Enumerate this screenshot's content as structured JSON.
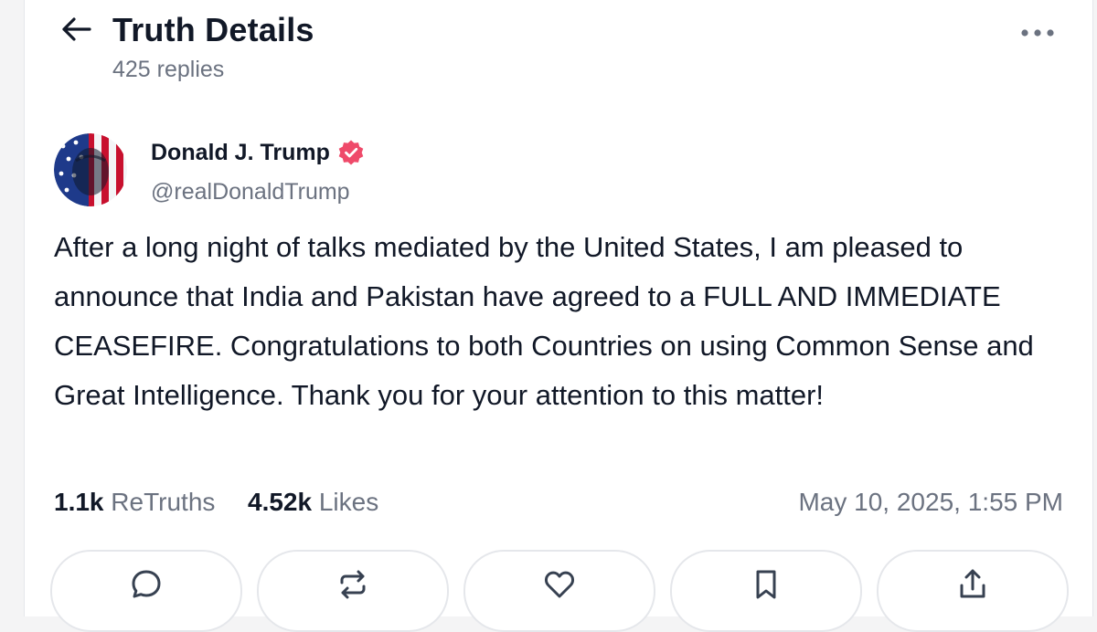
{
  "header": {
    "title": "Truth Details",
    "replies": "425 replies"
  },
  "author": {
    "name": "Donald J. Trump",
    "handle": "@realDonaldTrump",
    "verified_color": "#ef4a6a"
  },
  "post": {
    "text": "After a long night of talks mediated by the United States, I am pleased to announce that India and Pakistan have agreed to a FULL AND IMMEDIATE CEASEFIRE. Congratulations to both Countries on using Common Sense and Great Intelligence. Thank you for your attention to this matter!"
  },
  "stats": {
    "retruths_count": "1.1k",
    "retruths_label": "ReTruths",
    "likes_count": "4.52k",
    "likes_label": "Likes",
    "timestamp": "May 10, 2025, 1:55 PM"
  },
  "actions": [
    {
      "icon": "reply-icon"
    },
    {
      "icon": "retruth-icon"
    },
    {
      "icon": "heart-icon"
    },
    {
      "icon": "bookmark-icon"
    },
    {
      "icon": "share-icon"
    }
  ]
}
